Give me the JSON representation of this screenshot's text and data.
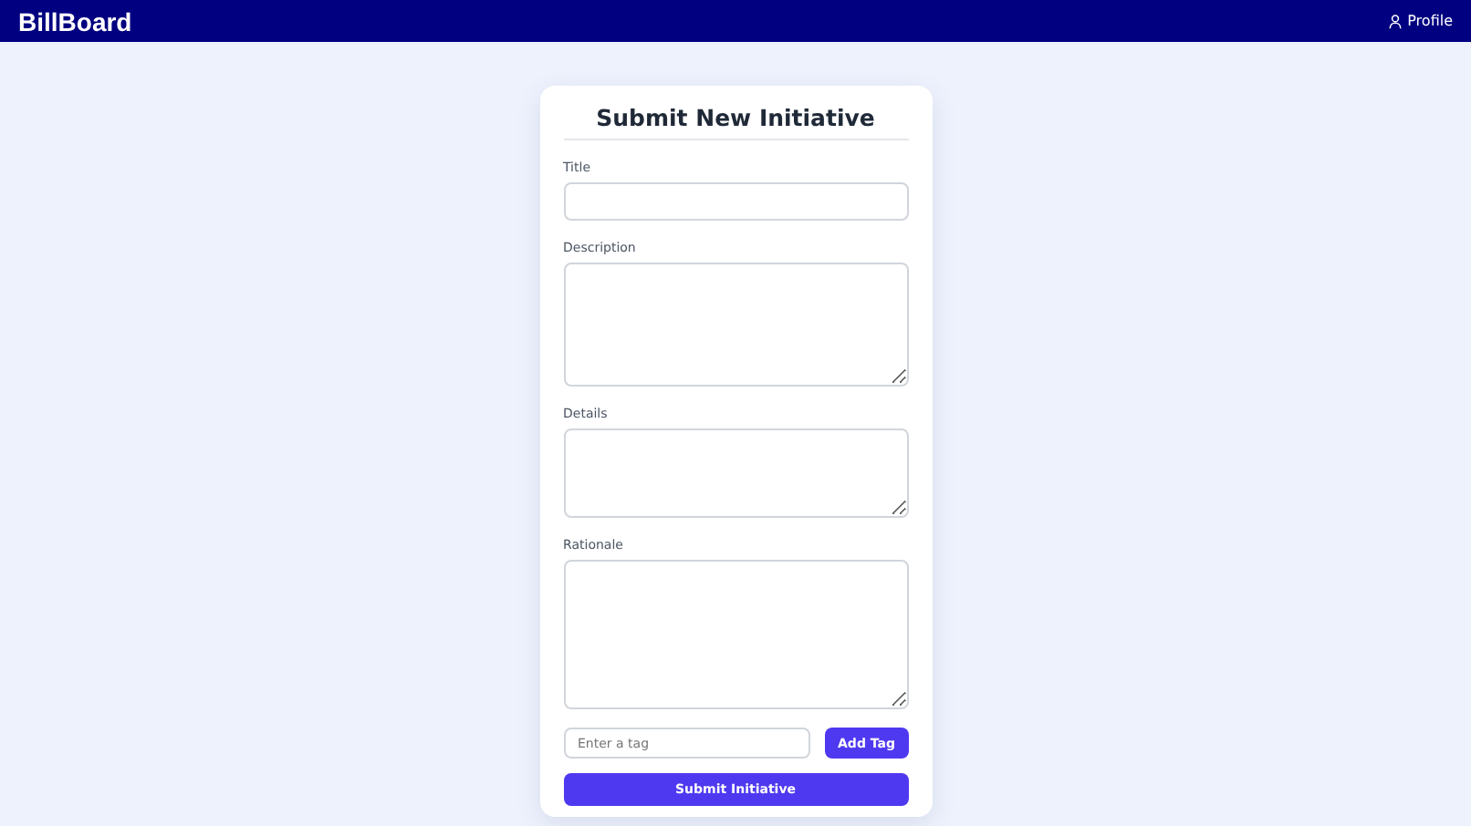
{
  "header": {
    "brand": "BillBoard",
    "profile_link": "Profile"
  },
  "form": {
    "title": "Submit New Initiative",
    "fields": [
      {
        "kind": "input",
        "label": "Title"
      },
      {
        "kind": "textarea",
        "label": "Description"
      },
      {
        "kind": "textarea",
        "label": "Details"
      },
      {
        "kind": "textarea",
        "label": "Rationale"
      }
    ],
    "tag_input": {
      "placeholder": "Enter a tag"
    },
    "add_tag_button": "Add Tag",
    "submit_button": "Submit Initiative"
  }
}
